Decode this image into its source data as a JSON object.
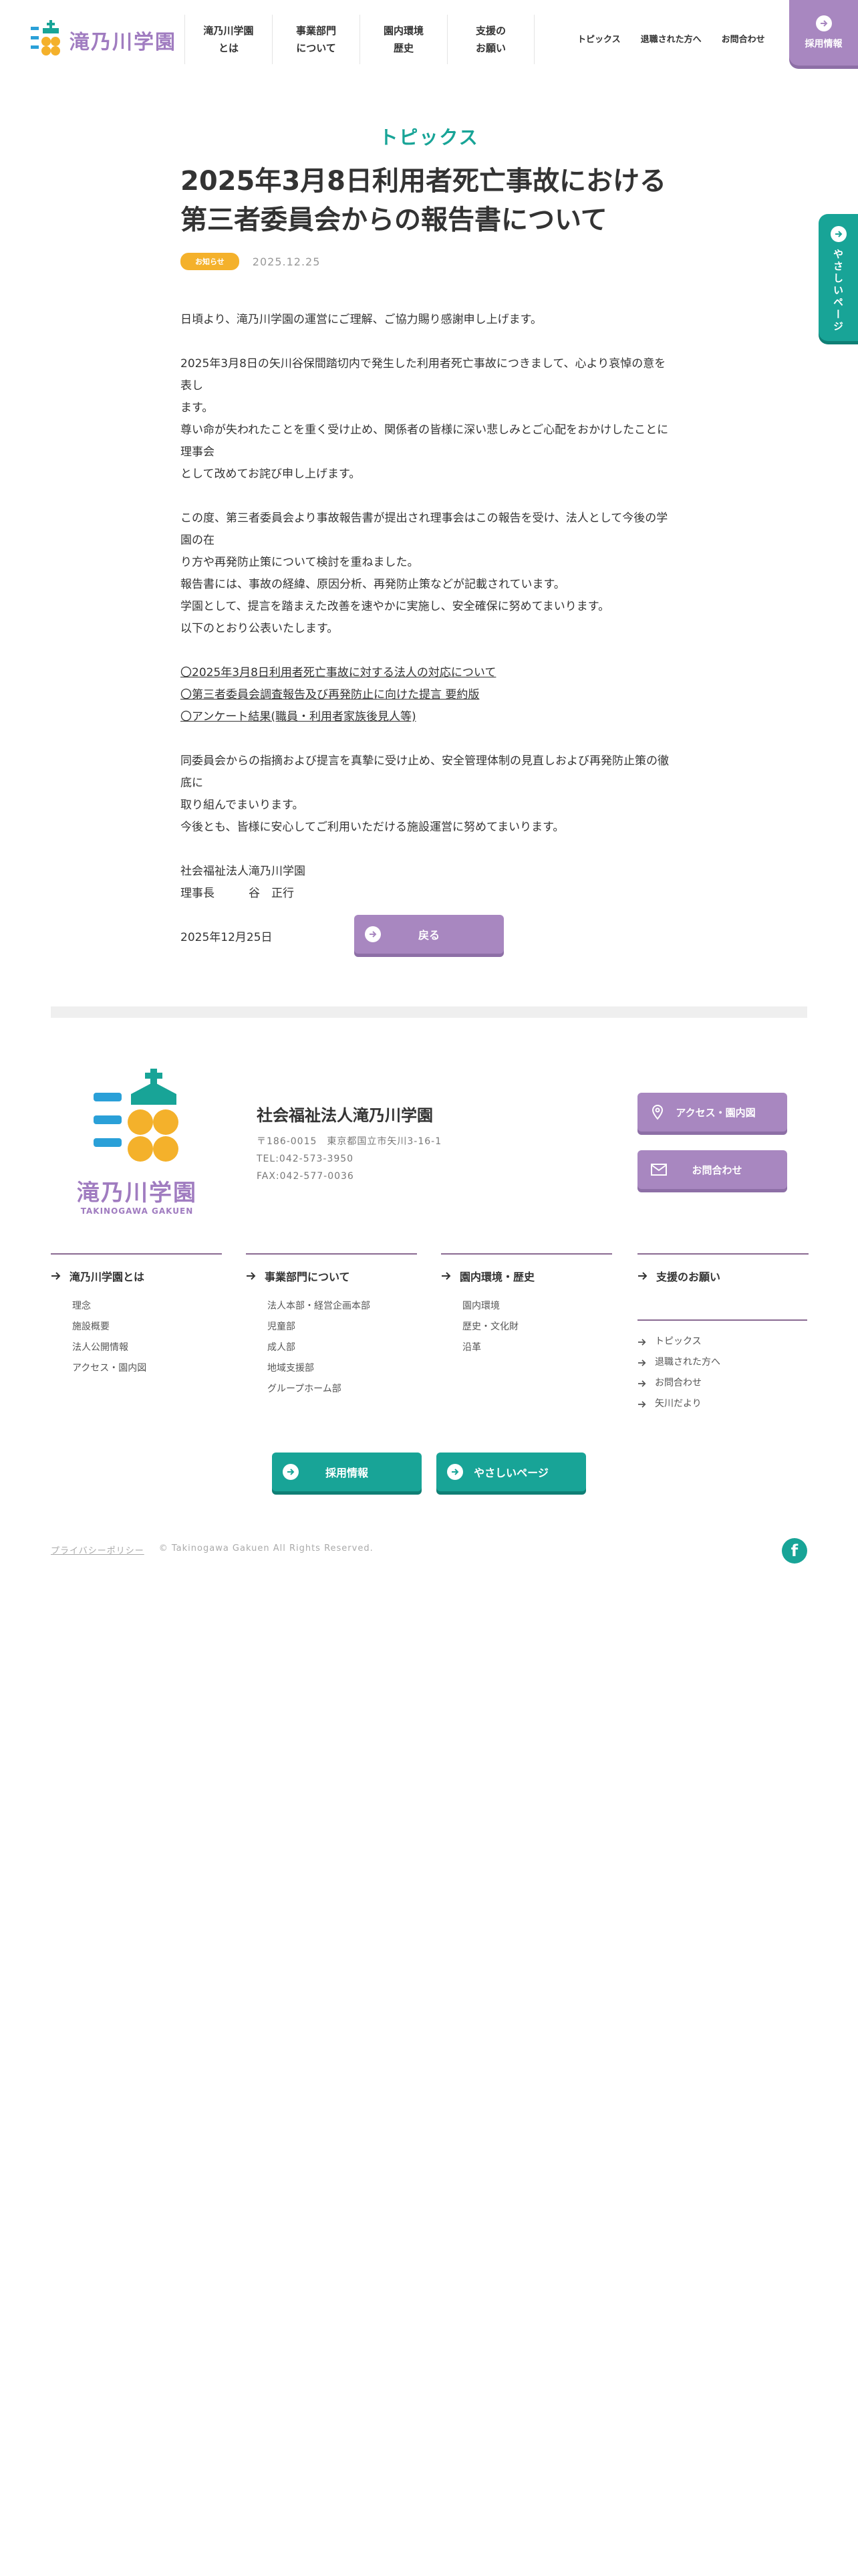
{
  "header": {
    "logo_text": "滝乃川学園",
    "nav": [
      "滝乃川学園\nとは",
      "事業部門\nについて",
      "園内環境\n歴史",
      "支援の\nお願い"
    ],
    "subnav": [
      "トピックス",
      "退職された方へ",
      "お問合わせ"
    ],
    "recruit": "採用情報",
    "side_tab": "やさしいページ"
  },
  "article": {
    "section": "トピックス",
    "title_line1": "2025年3月8日利用者死亡事故における",
    "title_line2": "第三者委員会からの報告書について",
    "badge": "お知らせ",
    "date": "2025.12.25",
    "p1": "日頃より、滝乃川学園の運営にご理解、ご協力賜り感謝申し上げます。",
    "p2_l1": "2025年3月8日の矢川谷保間踏切内で発生した利用者死亡事故につきまして、心より哀悼の意を表し",
    "p2_l2": "ます。",
    "p2_l3": "尊い命が失われたことを重く受け止め、関係者の皆様に深い悲しみとご心配をおかけしたことに理事会",
    "p2_l4": "として改めてお詫び申し上げます。",
    "p3_l1": "この度、第三者委員会より事故報告書が提出され理事会はこの報告を受け、法人として今後の学園の在",
    "p3_l2": "り方や再発防止策について検討を重ねました。",
    "p3_l3": "報告書には、事故の経緯、原因分析、再発防止策などが記載されています。",
    "p3_l4": "学園として、提言を踏まえた改善を速やかに実施し、安全確保に努めてまいります。",
    "p3_l5": "以下のとおり公表いたします。",
    "link1": "〇2025年3月8日利用者死亡事故に対する法人の対応について",
    "link2": "〇第三者委員会調査報告及び再発防止に向けた提言 要約版",
    "link3": "〇アンケート結果(職員・利用者家族後見人等)",
    "p5_l1": "同委員会からの指摘および提言を真摯に受け止め、安全管理体制の見直しおよび再発防止策の徹底に",
    "p5_l2": "取り組んでまいります。",
    "p5_l3": "今後とも、皆様に安心してご利用いただける施設運営に努めてまいります。",
    "sig1": "社会福祉法人滝乃川学園",
    "sig2": "理事長　　　谷　正行",
    "sig_date": "2025年12月25日",
    "back": "戻る"
  },
  "footer": {
    "logo_text": "滝乃川学園",
    "logo_sub": "TAKINOGAWA GAKUEN",
    "org_name": "社会福祉法人滝乃川学園",
    "address": "〒186-0015　東京都国立市矢川3-16-1",
    "tel": "TEL:042-573-3950",
    "fax": "FAX:042-577-0036",
    "access_btn": "アクセス・園内図",
    "contact_btn": "お問合わせ",
    "col1": {
      "head": "滝乃川学園とは",
      "items": [
        "理念",
        "施設概要",
        "法人公開情報",
        "アクセス・園内図"
      ]
    },
    "col2": {
      "head": "事業部門について",
      "items": [
        "法人本部・経営企画本部",
        "児童部",
        "成人部",
        "地域支援部",
        "グループホーム部"
      ]
    },
    "col3": {
      "head": "園内環境・歴史",
      "items": [
        "園内環境",
        "歴史・文化財",
        "沿革"
      ]
    },
    "col4": {
      "head": "支援のお願い",
      "items": [
        "トピックス",
        "退職された方へ",
        "お問合わせ",
        "矢川だより"
      ]
    },
    "recruit_btn": "採用情報",
    "easy_btn": "やさしいページ",
    "privacy": "プライバシーポリシー",
    "copyright": "© Takinogawa Gakuen All Rights Reserved.",
    "facebook": "f"
  },
  "colors": {
    "purple": "#a887c0",
    "teal": "#18a497",
    "yellow": "#f4b12b",
    "logo_purple": "#a07cc0"
  }
}
